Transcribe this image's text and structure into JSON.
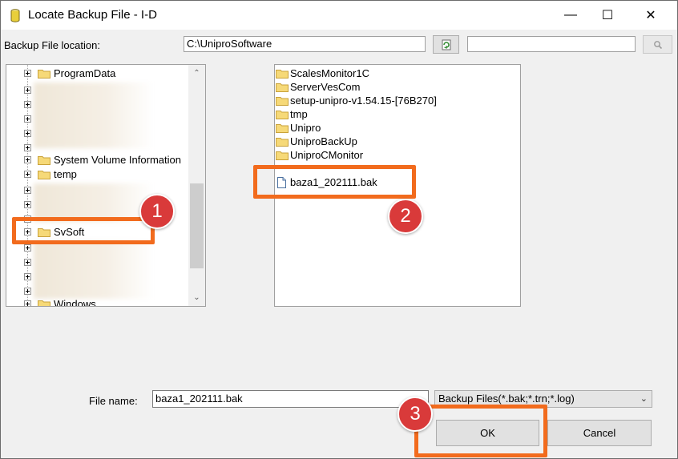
{
  "window": {
    "title": "Locate Backup File - I-D",
    "minimize_glyph": "—",
    "maximize_glyph": "☐",
    "close_glyph": "✕"
  },
  "location": {
    "label": "Backup File location:",
    "path_value": "C:\\UniproSoftware",
    "refresh_icon": "refresh-icon",
    "search_value": "",
    "search_icon": "magnifier-icon"
  },
  "tree": {
    "items": [
      {
        "label": "ProgramData"
      },
      {
        "label": "System Volume Information"
      },
      {
        "label": "temp"
      },
      {
        "label": "SvSoft"
      },
      {
        "label": "Windows"
      }
    ]
  },
  "files": {
    "folders": [
      {
        "label": "ScalesMonitor1C"
      },
      {
        "label": "ServerVesCom"
      },
      {
        "label": "setup-unipro-v1.54.15-[76B270]"
      },
      {
        "label": "tmp"
      },
      {
        "label": "Unipro"
      },
      {
        "label": "UniproBackUp"
      },
      {
        "label": "UniproCMonitor"
      }
    ],
    "backup_file": {
      "label": "baza1_202111.bak"
    }
  },
  "bottom": {
    "file_name_label": "File name:",
    "file_name_value": "baza1_202111.bak",
    "file_type_value": "Backup Files(*.bak;*.trn;*.log)",
    "ok_label": "OK",
    "cancel_label": "Cancel"
  },
  "annotations": {
    "badges": [
      "1",
      "2",
      "3"
    ],
    "color": "#f26b1d",
    "badge_color": "#d93a3a"
  }
}
